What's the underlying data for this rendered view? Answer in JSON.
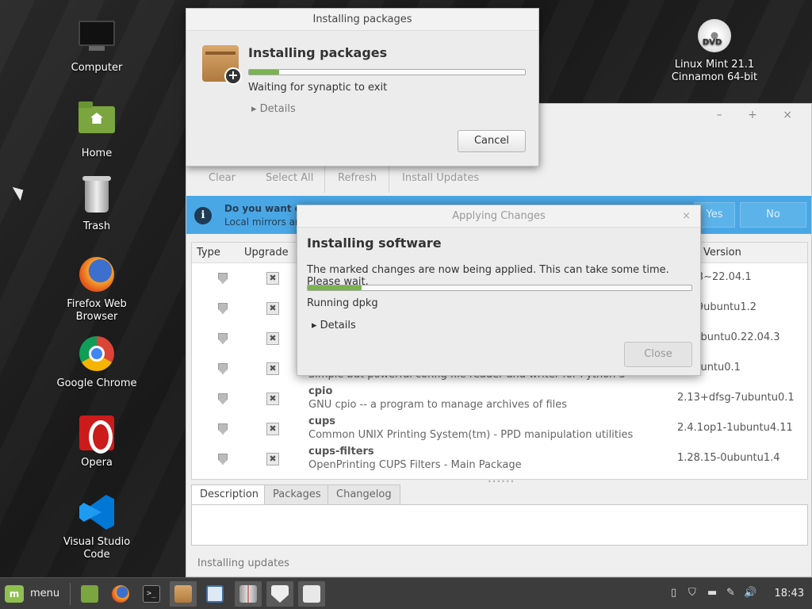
{
  "desktop": {
    "icons": [
      {
        "label": "Computer"
      },
      {
        "label": "Home"
      },
      {
        "label": "Trash"
      },
      {
        "label_line1": "Firefox Web",
        "label_line2": "Browser"
      },
      {
        "label": "Google Chrome"
      },
      {
        "label": "Opera"
      },
      {
        "label_line1": "Visual Studio",
        "label_line2": "Code"
      }
    ],
    "dvd": {
      "badge": "DVD",
      "line1": "Linux Mint 21.1",
      "line2": "Cinnamon 64-bit"
    }
  },
  "update_manager": {
    "window_controls": "– + ×",
    "toolbar": {
      "clear": "Clear",
      "select_all": "Select All",
      "refresh": "Refresh",
      "install_updates": "Install Updates"
    },
    "infobar": {
      "line1": "Do you want co",
      "line2": "Local mirrors ar",
      "yes": "Yes",
      "no": "No"
    },
    "columns": {
      "type": "Type",
      "upgrade": "Upgrade",
      "version": "Version"
    },
    "rows": [
      {
        "name": "",
        "desc": "",
        "version": "0203~22.04.1"
      },
      {
        "name": "",
        "desc": "",
        "version": "0909ubuntu1.2"
      },
      {
        "name": "",
        "desc": "",
        "version": "1-1ubuntu0.22.04.3"
      },
      {
        "name": "",
        "desc": "Simple but powerful config file reader and writer for Python 3",
        "version": "-5ubuntu0.1"
      },
      {
        "name": "cpio",
        "desc": "GNU cpio -- a program to manage archives of files",
        "version": "2.13+dfsg-7ubuntu0.1"
      },
      {
        "name": "cups",
        "desc": "Common UNIX Printing System(tm) - PPD manipulation utilities",
        "version": "2.4.1op1-1ubuntu4.11"
      },
      {
        "name": "cups-filters",
        "desc": "OpenPrinting CUPS Filters - Main Package",
        "version": "1.28.15-0ubuntu1.4"
      }
    ],
    "tabs": {
      "description": "Description",
      "packages": "Packages",
      "changelog": "Changelog"
    },
    "status": "Installing updates"
  },
  "dialog_packages": {
    "title": "Installing packages",
    "heading": "Installing packages",
    "progress": 0.11,
    "status": "Waiting for synaptic to exit",
    "details": "Details",
    "cancel": "Cancel"
  },
  "dialog_apply": {
    "title": "Applying Changes",
    "close_x": "×",
    "heading": "Installing software",
    "message": "The marked changes are now being applied. This can take some time. Please wait.",
    "progress": 0.14,
    "status": "Running dpkg",
    "details": "Details",
    "close": "Close"
  },
  "taskbar": {
    "menu_label": "menu",
    "clock": "18:43",
    "apps": [
      "files-icon",
      "firefox-icon",
      "terminal-icon",
      "package-installer-icon",
      "text-editor-icon",
      "app-icon",
      "update-manager-icon",
      "image-icon"
    ]
  },
  "colors": {
    "infobar": "#4aa7e5",
    "progress": "#7ab34f",
    "mint": "#8fc04f"
  }
}
